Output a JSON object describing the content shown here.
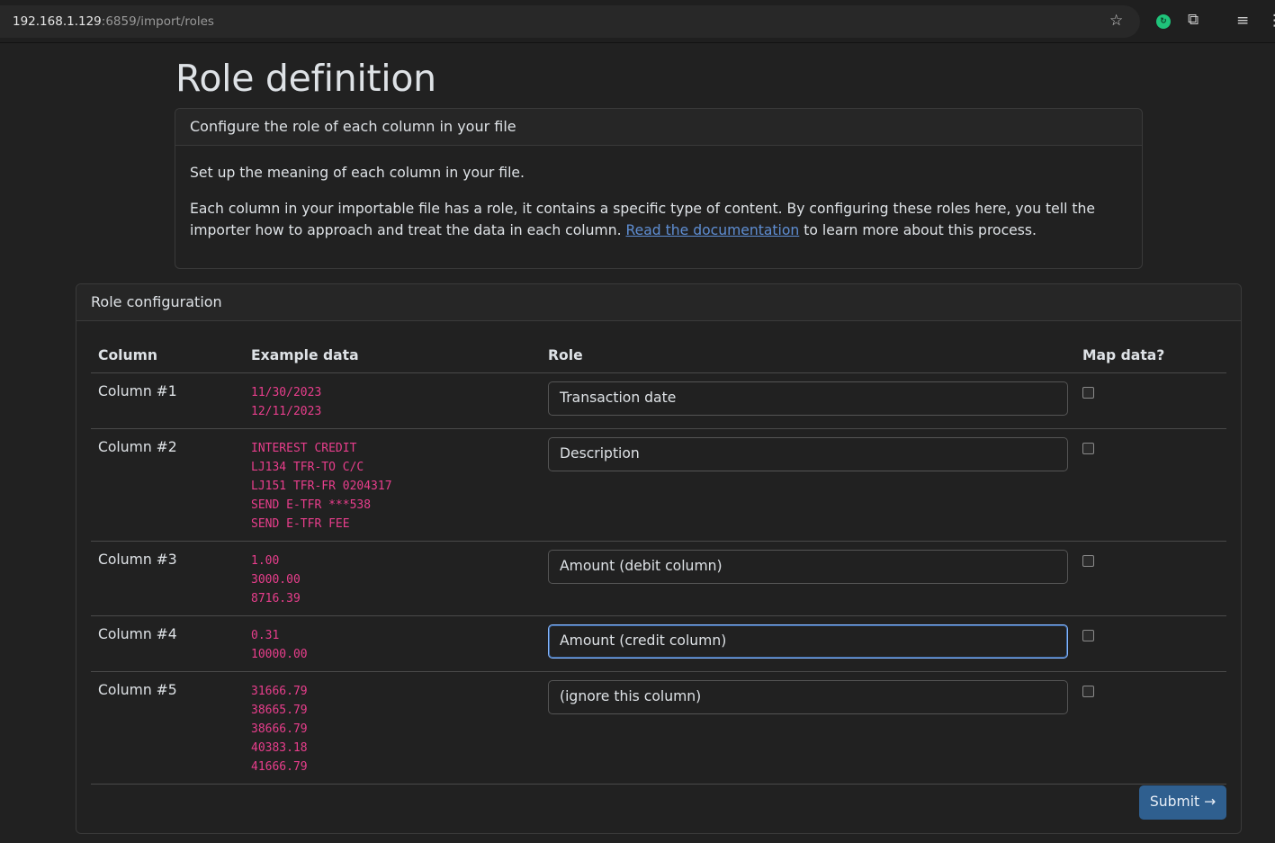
{
  "browser": {
    "host": "192.168.1.129",
    "path": ":6859/import/roles"
  },
  "page": {
    "title": "Role definition"
  },
  "intro_card": {
    "header": "Configure the role of each column in your file",
    "p1": "Set up the meaning of each column in your file.",
    "p2_before": "Each column in your importable file has a role, it contains a specific type of content. By configuring these roles here, you tell the importer how to approach and treat the data in each column.",
    "link_text": "Read the documentation",
    "p2_after": "to learn more about this process."
  },
  "roles_card": {
    "header": "Role configuration",
    "columns": {
      "column": "Column",
      "example": "Example data",
      "role": "Role",
      "map": "Map data?"
    },
    "rows": [
      {
        "name": "Column #1",
        "examples": [
          "11/30/2023",
          "12/11/2023"
        ],
        "role": "Transaction date",
        "map": false
      },
      {
        "name": "Column #2",
        "examples": [
          "INTEREST CREDIT",
          "LJ134 TFR-TO C/C",
          "LJ151 TFR-FR 0204317",
          "SEND E-TFR ***538",
          "SEND E-TFR FEE"
        ],
        "role": "Description",
        "map": false
      },
      {
        "name": "Column #3",
        "examples": [
          "1.00",
          "3000.00",
          "8716.39"
        ],
        "role": "Amount (debit column)",
        "map": false
      },
      {
        "name": "Column #4",
        "examples": [
          "0.31",
          "10000.00"
        ],
        "role": "Amount (credit column)",
        "map": false
      },
      {
        "name": "Column #5",
        "examples": [
          "31666.79",
          "38665.79",
          "38666.79",
          "40383.18",
          "41666.79"
        ],
        "role": "(ignore this column)",
        "map": false
      }
    ],
    "submit": "Submit →"
  }
}
